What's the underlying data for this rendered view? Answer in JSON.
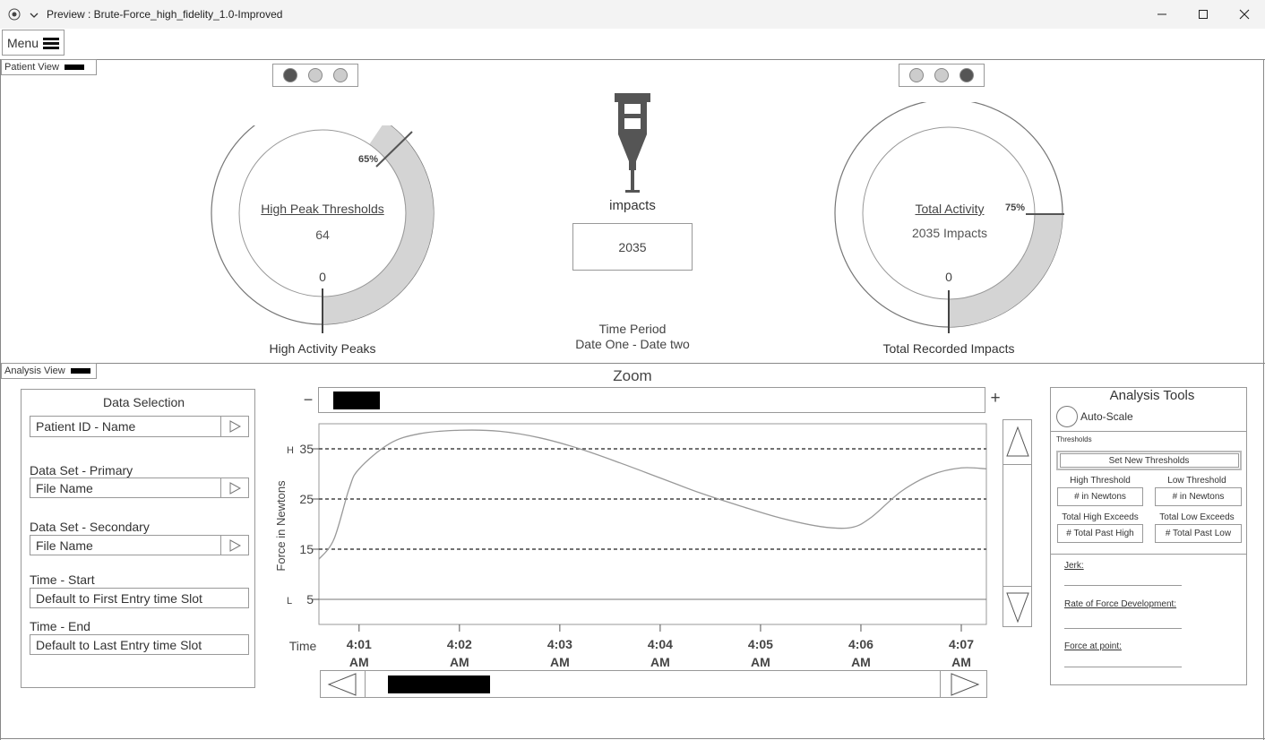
{
  "window": {
    "title": "Preview : Brute-Force_high_fidelity_1.0-Improved",
    "minimize": "—",
    "maximize": "☐",
    "close": "✕"
  },
  "menu": {
    "label": "Menu"
  },
  "patient_view": {
    "tag": "Patient View",
    "left_pager": [
      false,
      false,
      false
    ],
    "right_pager": [
      false,
      false,
      true
    ],
    "left_gauge": {
      "title": "High Peak Thresholds",
      "value": "64",
      "zero": "0",
      "percent_label": "65%",
      "percent": 0.65,
      "caption": "High Activity Peaks"
    },
    "center": {
      "icon": "syringe-icon",
      "impacts_label": "impacts",
      "impacts_value": "2035",
      "time_period_label": "Time Period",
      "date_range": "Date One - Date two"
    },
    "right_gauge": {
      "title": "Total Activity",
      "value": "2035 Impacts",
      "zero": "0",
      "percent_label": "75%",
      "percent": 0.75,
      "caption": "Total Recorded Impacts"
    }
  },
  "analysis_view": {
    "tag": "Analysis View",
    "data_selection": {
      "title": "Data Selection",
      "patient": "Patient ID - Name",
      "primary_label": "Data Set - Primary",
      "primary_value": "File Name",
      "secondary_label": "Data Set - Secondary",
      "secondary_value": "File Name",
      "start_label": "Time - Start",
      "start_value": "Default to First Entry time Slot",
      "end_label": "Time - End",
      "end_value": "Default to Last Entry time Slot"
    },
    "zoom": {
      "label": "Zoom",
      "minus": "−",
      "plus": "+"
    },
    "analysis_tools": {
      "title": "Analysis Tools",
      "autoscale": "Auto-Scale",
      "thresholds_label": "Thresholds",
      "set_button": "Set New Thresholds",
      "high_threshold_label": "High Threshold",
      "high_threshold_value": "# in Newtons",
      "low_threshold_label": "Low Threshold",
      "low_threshold_value": "# in Newtons",
      "total_high_label": "Total High Exceeds",
      "total_high_value": "# Total Past High",
      "total_low_label": "Total Low Exceeds",
      "total_low_value": "# Total Past Low",
      "jerk_label": "Jerk:",
      "rfd_label": "Rate of Force Development:",
      "force_point_label": "Force at point:"
    }
  },
  "chart_data": {
    "type": "line",
    "ylabel": "Force in Newtons",
    "xlabel": "Time",
    "y_ticks": [
      "35",
      "25",
      "15",
      "5"
    ],
    "y_tick_values": [
      35,
      25,
      15,
      5
    ],
    "ylim": [
      0,
      40
    ],
    "threshold_markers": [
      {
        "label": "H",
        "value": 35
      },
      {
        "label": "L",
        "value": 5
      }
    ],
    "dashed_lines": [
      35,
      25,
      15
    ],
    "solid_lines": [
      5
    ],
    "x_tick_times": [
      "4:01",
      "4:02",
      "4:03",
      "4:04",
      "4:05",
      "4:06",
      "4:07"
    ],
    "x_tick_periods": [
      "AM",
      "AM",
      "AM",
      "AM",
      "AM",
      "AM",
      "AM"
    ],
    "xlim": [
      0.6,
      7.25
    ],
    "series": [
      {
        "x": [
          0.6,
          0.75,
          0.9,
          1.0,
          1.3,
          1.6,
          2.0,
          2.4,
          2.8,
          3.2,
          3.6,
          4.0,
          4.4,
          4.8,
          5.2,
          5.6,
          5.9,
          6.1,
          6.4,
          6.7,
          7.0,
          7.25
        ],
        "y": [
          13,
          17,
          27,
          31,
          36,
          38,
          38.7,
          38.5,
          37.2,
          35,
          32.2,
          29.2,
          26.2,
          23.6,
          21.2,
          19.5,
          19.3,
          21.3,
          26.5,
          29.8,
          31.2,
          31
        ]
      }
    ],
    "grid": false
  }
}
